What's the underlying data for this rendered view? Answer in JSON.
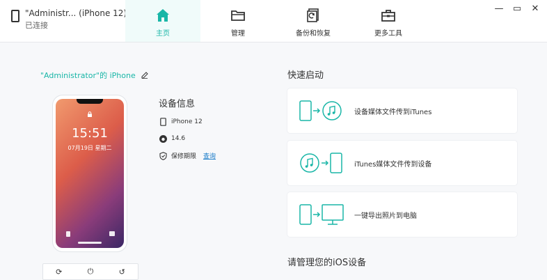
{
  "device_chip": {
    "name": "\"Administr... (iPhone 12)",
    "status": "已连接"
  },
  "nav": {
    "tabs": [
      {
        "label": "主页",
        "icon": "home-icon"
      },
      {
        "label": "管理",
        "icon": "folder-icon"
      },
      {
        "label": "备份和恢复",
        "icon": "backup-icon"
      },
      {
        "label": "更多工具",
        "icon": "toolbox-icon"
      }
    ]
  },
  "window": {
    "minimize": "—",
    "restore": "▭",
    "close": "✕"
  },
  "device": {
    "title": "\"Administrator\"的 iPhone",
    "lock_time": "15:51",
    "lock_date": "07月19日 星期二"
  },
  "device_info": {
    "heading": "设备信息",
    "model": "iPhone 12",
    "ios_version": "14.6",
    "warranty_label": "保修期限",
    "warranty_link": "查询"
  },
  "quick_start": {
    "heading": "快速启动",
    "items": [
      {
        "label": "设备媒体文件传到iTunes"
      },
      {
        "label": "iTunes媒体文件传到设备"
      },
      {
        "label": "一键导出照片到电脑"
      }
    ]
  },
  "manage": {
    "heading": "请管理您的iOS设备"
  },
  "colors": {
    "accent": "#19b6a7",
    "link": "#1a7cc9"
  }
}
